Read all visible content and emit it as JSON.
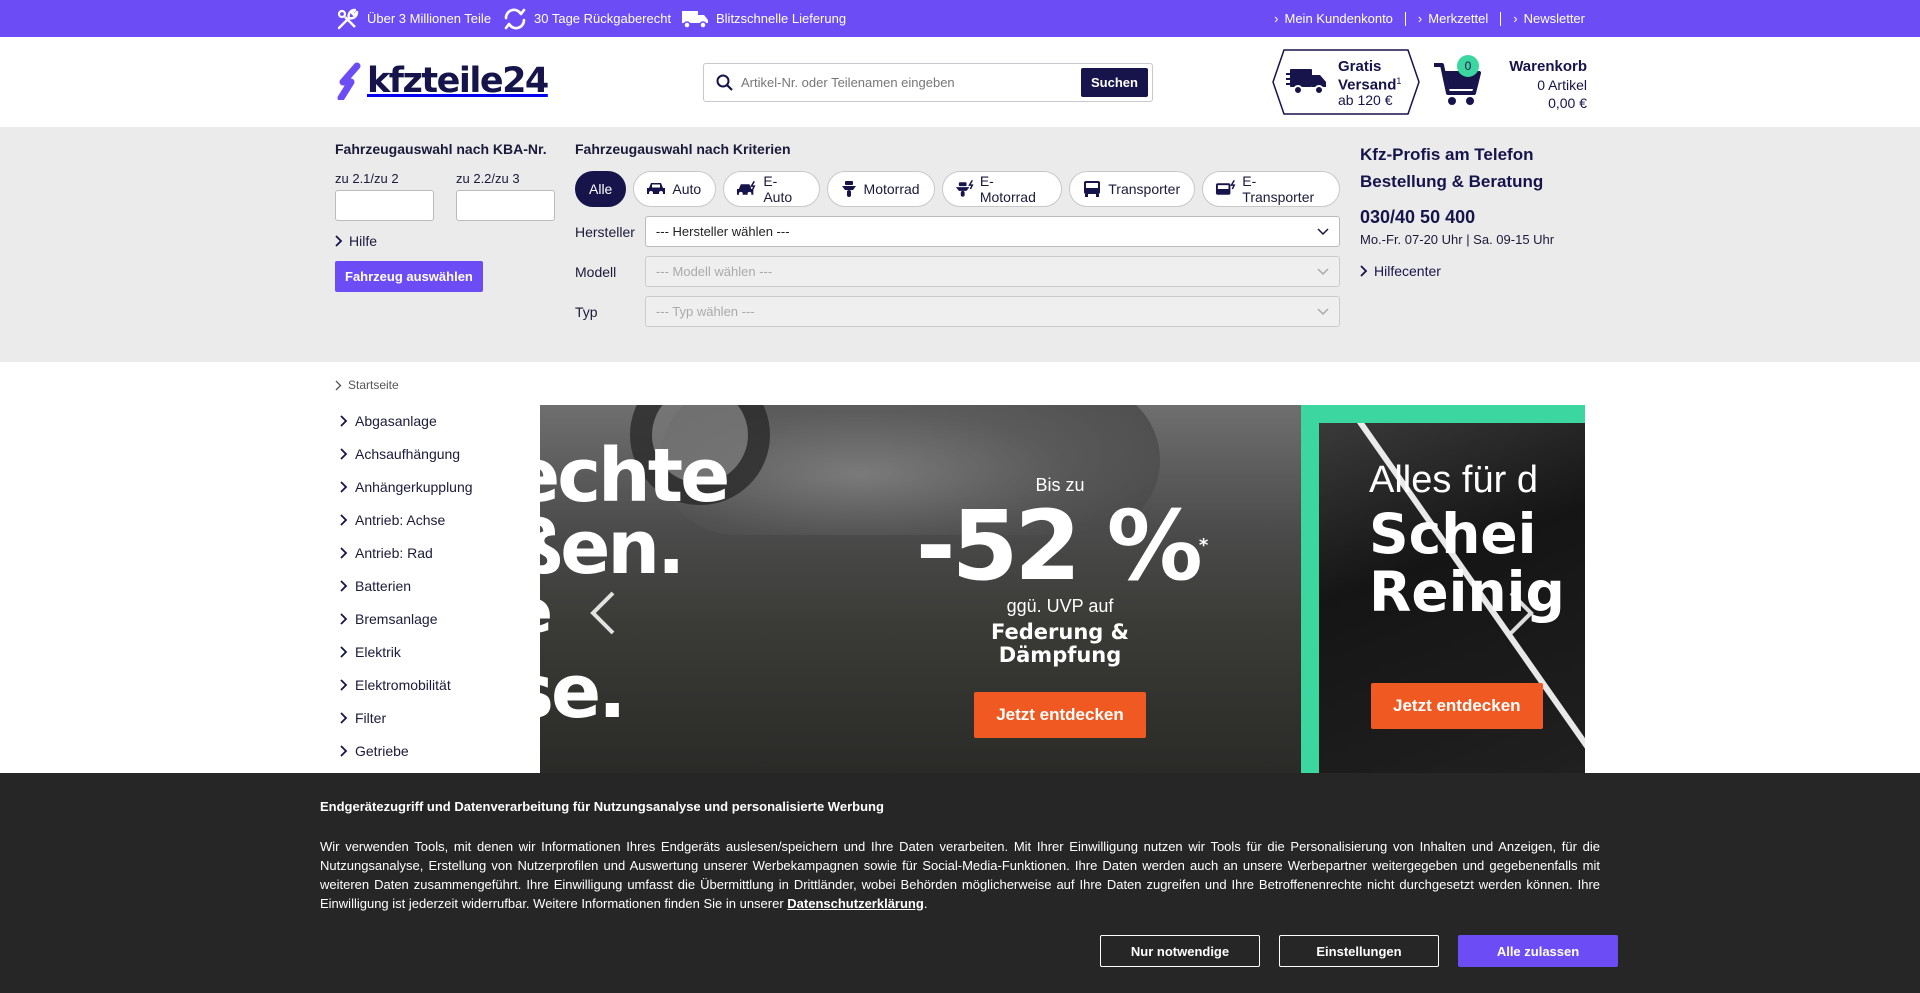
{
  "topbar": {
    "usps": [
      "Über 3 Millionen Teile",
      "30 Tage Rückgaberecht",
      "Blitzschnelle Lieferung"
    ],
    "links": [
      "Mein Kundenkonto",
      "Merkzettel",
      "Newsletter"
    ]
  },
  "header": {
    "logo": "kfzteile24",
    "search_placeholder": "Artikel-Nr. oder Teilenamen eingeben",
    "search_button": "Suchen",
    "shipping_line1": "Gratis",
    "shipping_line2": "Versand",
    "shipping_sup": "1",
    "shipping_line3": "ab 120 €",
    "cart_count": "0",
    "cart_title": "Warenkorb",
    "cart_items": "0 Artikel",
    "cart_total": "0,00 €"
  },
  "kba": {
    "title": "Fahrzeugauswahl nach KBA-Nr.",
    "label1": "zu 2.1/zu 2",
    "label2": "zu 2.2/zu 3",
    "help": "Hilfe",
    "button": "Fahrzeug auswählen"
  },
  "criteria": {
    "title": "Fahrzeugauswahl nach Kriterien",
    "pills": [
      "Alle",
      "Auto",
      "E-Auto",
      "Motorrad",
      "E-Motorrad",
      "Transporter",
      "E-Transporter"
    ],
    "manufacturer_label": "Hersteller",
    "manufacturer_value": "--- Hersteller wählen ---",
    "model_label": "Modell",
    "model_value": "--- Modell wählen ---",
    "type_label": "Typ",
    "type_value": "--- Typ wählen ---"
  },
  "phone": {
    "title1": "Kfz-Profis am Telefon",
    "title2": "Bestellung & Beratung",
    "number": "030/40 50 400",
    "hours": "Mo.-Fr. 07-20 Uhr | Sa. 09-15 Uhr",
    "help": "Hilfecenter"
  },
  "breadcrumb": "Startseite",
  "categories": [
    "Abgasanlage",
    "Achsaufhängung",
    "Anhängerkupplung",
    "Antrieb: Achse",
    "Antrieb: Rad",
    "Batterien",
    "Bremsanlage",
    "Elektrik",
    "Elektromobilität",
    "Filter",
    "Getriebe"
  ],
  "banner": {
    "text_line1": "echte",
    "text_line2": "ßen.",
    "text_line3": "e",
    "text_line4": "se.",
    "upto": "Bis zu",
    "percent": "-52 %",
    "asterisk": "*",
    "uvp": "ggü. UVP auf",
    "category1": "Federung &",
    "category2": "Dämpfung",
    "cta": "Jetzt entdecken",
    "slide2_line1": "Alles für d",
    "slide2_line2": "Schei",
    "slide2_line3": "Reinig",
    "slide2_cta": "Jetzt entdecken"
  },
  "cookie": {
    "title": "Endgerätezugriff und Datenverarbeitung für Nutzungsanalyse und personalisierte Werbung",
    "text": "Wir verwenden Tools, mit denen wir Informationen Ihres Endgeräts auslesen/speichern und Ihre Daten verarbeiten. Mit Ihrer Einwilligung nutzen wir Tools für die Personalisierung von Inhalten und Anzeigen, für die Nutzungsanalyse, Erstellung von Nutzerprofilen und Auswertung unserer Werbekampagnen sowie für Social-Media-Funktionen. Ihre Daten werden auch an unsere Werbepartner weitergegeben und gegebenenfalls mit weiteren Daten zusammengeführt. Ihre Einwilligung umfasst die Übermittlung in Drittländer, wobei Behörden möglicherweise auf Ihre Daten zugreifen und Ihre Betroffenenrechte nicht durchgesetzt werden können. Ihre Einwilligung ist jederzeit widerrufbar. Weitere Informationen finden Sie in unserer ",
    "link": "Datenschutzerklärung",
    "period": ".",
    "btn_necessary": "Nur notwendige",
    "btn_settings": "Einstellungen",
    "btn_accept": "Alle zulassen"
  },
  "colors": {
    "brand_purple": "#6c4df5",
    "navy": "#16144a",
    "accent_green": "#3cd6a0",
    "cta_orange": "#f05a22"
  }
}
